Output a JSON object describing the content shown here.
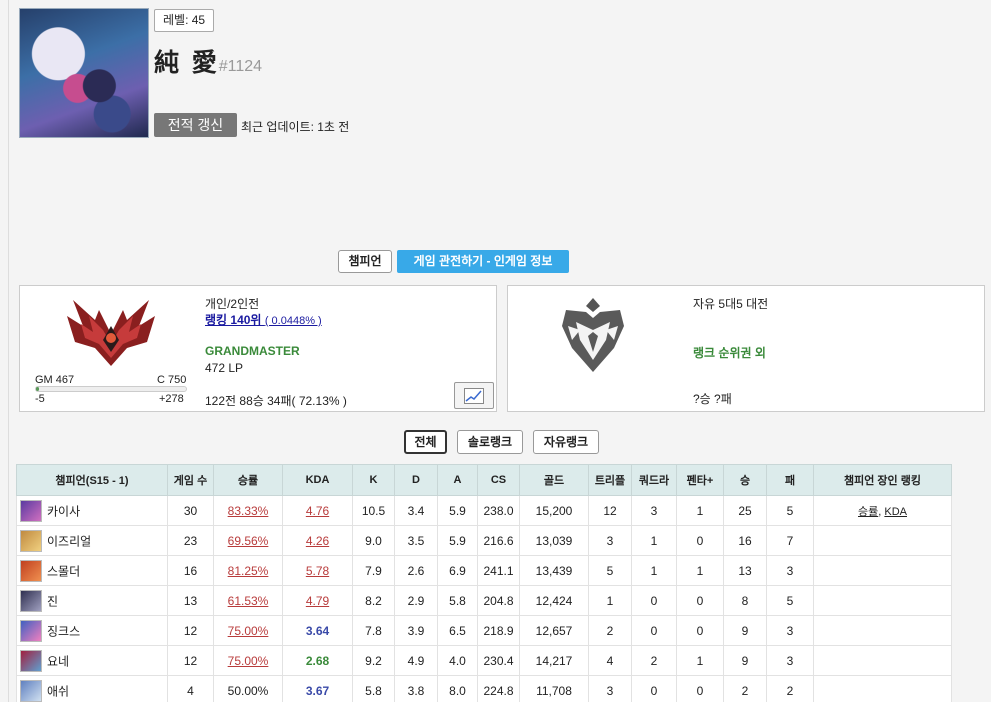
{
  "profile": {
    "level": "레벨: 45",
    "name": "純 愛",
    "tag": "#1124",
    "refresh_label": "전적 갱신",
    "last_update": "최근 업데이트: 1초 전"
  },
  "tabs": {
    "champion": "챔피언",
    "spectate": "게임 관전하기 - 인게임 정보"
  },
  "solo": {
    "queue": "개인/2인전",
    "ranking": "랭킹 140위",
    "ranking_pct": "( 0.0448% )",
    "tier": "GRANDMASTER",
    "lp": "472 LP",
    "record": "122전 88승 34패( 72.13% )",
    "gm_label": "GM 467",
    "c_label": "C 750",
    "lp_min": "-5",
    "lp_max": "+278",
    "lp_progress": 0.02
  },
  "flex": {
    "queue": "자유 5대5 대전",
    "status": "랭크 순위권 외",
    "record": "?승 ?패"
  },
  "filters": [
    "전체",
    "솔로랭크",
    "자유랭크"
  ],
  "table": {
    "headers": [
      "챔피언(S15 - 1)",
      "게임 수",
      "승률",
      "KDA",
      "K",
      "D",
      "A",
      "CS",
      "골드",
      "트리플",
      "쿼드라",
      "펜타+",
      "승",
      "패",
      "챔피언 장인 랭킹"
    ],
    "rows": [
      {
        "champ": "카이사",
        "games": "30",
        "winrate": "83.33%",
        "kda": "4.76",
        "k": "10.5",
        "d": "3.4",
        "a": "5.9",
        "cs": "238.0",
        "gold": "15,200",
        "triple": "12",
        "quadra": "3",
        "penta": "1",
        "win": "25",
        "loss": "5"
      },
      {
        "champ": "이즈리얼",
        "games": "23",
        "winrate": "69.56%",
        "kda": "4.26",
        "k": "9.0",
        "d": "3.5",
        "a": "5.9",
        "cs": "216.6",
        "gold": "13,039",
        "triple": "3",
        "quadra": "1",
        "penta": "0",
        "win": "16",
        "loss": "7"
      },
      {
        "champ": "스몰더",
        "games": "16",
        "winrate": "81.25%",
        "kda": "5.78",
        "k": "7.9",
        "d": "2.6",
        "a": "6.9",
        "cs": "241.1",
        "gold": "13,439",
        "triple": "5",
        "quadra": "1",
        "penta": "1",
        "win": "13",
        "loss": "3"
      },
      {
        "champ": "진",
        "games": "13",
        "winrate": "61.53%",
        "kda": "4.79",
        "k": "8.2",
        "d": "2.9",
        "a": "5.8",
        "cs": "204.8",
        "gold": "12,424",
        "triple": "1",
        "quadra": "0",
        "penta": "0",
        "win": "8",
        "loss": "5"
      },
      {
        "champ": "징크스",
        "games": "12",
        "winrate": "75.00%",
        "kda": "3.64",
        "k": "7.8",
        "d": "3.9",
        "a": "6.5",
        "cs": "218.9",
        "gold": "12,657",
        "triple": "2",
        "quadra": "0",
        "penta": "0",
        "win": "9",
        "loss": "3"
      },
      {
        "champ": "요네",
        "games": "12",
        "winrate": "75.00%",
        "kda": "2.68",
        "k": "9.2",
        "d": "4.9",
        "a": "4.0",
        "cs": "230.4",
        "gold": "14,217",
        "triple": "4",
        "quadra": "2",
        "penta": "1",
        "win": "9",
        "loss": "3"
      },
      {
        "champ": "애쉬",
        "games": "4",
        "winrate": "50.00%",
        "kda": "3.67",
        "k": "5.8",
        "d": "3.8",
        "a": "8.0",
        "cs": "224.8",
        "gold": "11,708",
        "triple": "3",
        "quadra": "0",
        "penta": "0",
        "win": "2",
        "loss": "2"
      }
    ],
    "mastery_links": [
      "승률",
      "KDA"
    ]
  }
}
